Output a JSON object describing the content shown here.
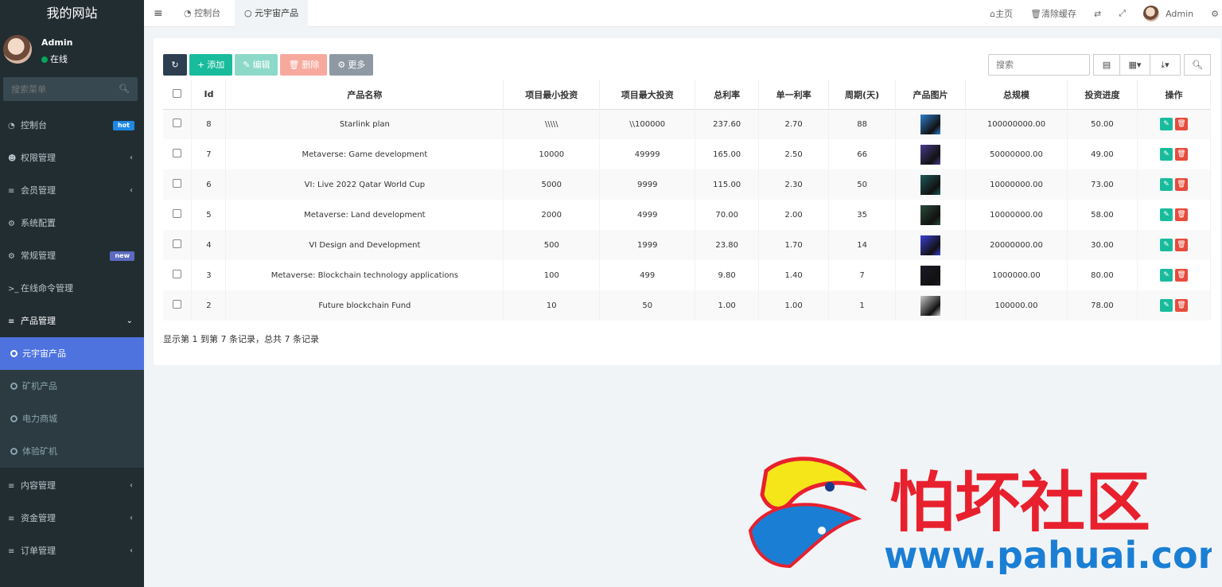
{
  "sidebar": {
    "brand": "我的网站",
    "user": {
      "name": "Admin",
      "status": "在线"
    },
    "search_placeholder": "搜索菜单",
    "items": [
      {
        "label": "控制台",
        "icon": "dashboard-icon",
        "badge": "hot"
      },
      {
        "label": "权限管理",
        "icon": "users-icon"
      },
      {
        "label": "会员管理",
        "icon": "list-icon"
      },
      {
        "label": "系统配置",
        "icon": "gear-icon"
      },
      {
        "label": "常规管理",
        "icon": "cogs-icon",
        "badge": "new"
      },
      {
        "label": "在线命令管理",
        "icon": "terminal-icon"
      },
      {
        "label": "产品管理",
        "icon": "list-icon"
      }
    ],
    "submenu": [
      "元宇宙产品",
      "矿机产品",
      "电力商城",
      "体验矿机"
    ],
    "bottom_items": [
      {
        "label": "内容管理",
        "icon": "list-icon"
      },
      {
        "label": "资金管理",
        "icon": "list-icon"
      },
      {
        "label": "订单管理",
        "icon": "list-icon"
      }
    ]
  },
  "topbar": {
    "tabs": [
      "控制台",
      "元宇宙产品"
    ],
    "links": {
      "home": "主页",
      "clear_cache": "清除缓存",
      "user": "Admin"
    }
  },
  "toolbar": {
    "add": "添加",
    "edit": "编辑",
    "delete": "删除",
    "more": "更多",
    "search_placeholder": "搜索"
  },
  "table": {
    "headers": [
      "Id",
      "产品名称",
      "项目最小投资",
      "项目最大投资",
      "总利率",
      "单一利率",
      "周期(天)",
      "产品图片",
      "总规模",
      "投资进度",
      "操作"
    ],
    "rows": [
      {
        "id": "8",
        "name": "Starlink plan",
        "min": "\\\\\\\\\\",
        "max": "\\\\100000",
        "total_rate": "237.60",
        "single_rate": "2.70",
        "cycle": "88",
        "scale": "100000000.00",
        "progress": "50.00",
        "img_color": "#2f7fd0"
      },
      {
        "id": "7",
        "name": "Metaverse: Game development",
        "min": "10000",
        "max": "49999",
        "total_rate": "165.00",
        "single_rate": "2.50",
        "cycle": "66",
        "scale": "50000000.00",
        "progress": "49.00",
        "img_color": "#4a3a8c"
      },
      {
        "id": "6",
        "name": "VI: Live 2022 Qatar World Cup",
        "min": "5000",
        "max": "9999",
        "total_rate": "115.00",
        "single_rate": "2.30",
        "cycle": "50",
        "scale": "10000000.00",
        "progress": "73.00",
        "img_color": "#1f5a5a"
      },
      {
        "id": "5",
        "name": "Metaverse: Land development",
        "min": "2000",
        "max": "4999",
        "total_rate": "70.00",
        "single_rate": "2.00",
        "cycle": "35",
        "scale": "10000000.00",
        "progress": "58.00",
        "img_color": "#2c4a3a"
      },
      {
        "id": "4",
        "name": "VI Design and Development",
        "min": "500",
        "max": "1999",
        "total_rate": "23.80",
        "single_rate": "1.70",
        "cycle": "14",
        "scale": "20000000.00",
        "progress": "30.00",
        "img_color": "#3b3fd8"
      },
      {
        "id": "3",
        "name": "Metaverse: Blockchain technology applications",
        "min": "100",
        "max": "499",
        "total_rate": "9.80",
        "single_rate": "1.40",
        "cycle": "7",
        "scale": "1000000.00",
        "progress": "80.00",
        "img_color": "#1a1a2a"
      },
      {
        "id": "2",
        "name": "Future blockchain Fund",
        "min": "10",
        "max": "50",
        "total_rate": "1.00",
        "single_rate": "1.00",
        "cycle": "1",
        "scale": "100000.00",
        "progress": "78.00",
        "img_color": "#c9c9c9"
      }
    ]
  },
  "pager_text": "显示第 1 到第 7 条记录，总共 7 条记录",
  "watermark": {
    "title": "怕坏社区",
    "url": "www.pahuai.com"
  },
  "colors": {
    "sidebar_bg": "#222d32",
    "active": "#4e73df",
    "success": "#18bc9c",
    "danger": "#e74c3c",
    "watermark_red": "#e8202e",
    "watermark_blue": "#1a7fd4"
  }
}
